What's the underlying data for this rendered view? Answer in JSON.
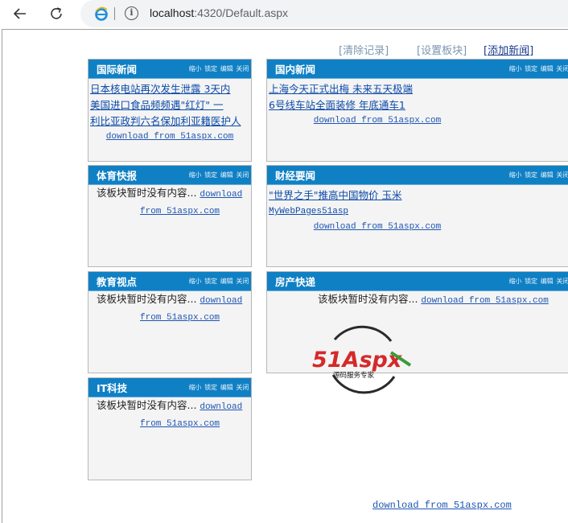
{
  "browser": {
    "url_host": "localhost",
    "url_rest": ":4320/Default.aspx"
  },
  "top_links": {
    "clear": "[清除记录]",
    "settings": "[设置板块]",
    "add_news": "[添加新闻]"
  },
  "block_actions": [
    "缩小",
    "锁定",
    "编辑",
    "关闭"
  ],
  "download_text": "download from 51aspx.com",
  "download_word": "download",
  "download_from": "from 51aspx.com",
  "empty_text": "该板块暂时没有内容...",
  "blocks": {
    "intl": {
      "title": "国际新闻",
      "items": [
        "日本核电站再次发生泄露 3天内",
        "美国进口食品频频遇\"红灯\" 一",
        "利比亚政判六名保加利亚籍医护人"
      ]
    },
    "domestic": {
      "title": "国内新闻",
      "items": [
        "上海今天正式出梅  未来五天极端",
        "6号线车站全面装修 年底通车1"
      ]
    },
    "sports": {
      "title": "体育快报"
    },
    "finance": {
      "title": "财经要闻",
      "items": [
        "\"世界之手\"推高中国物价 玉米",
        "MyWebPages51asp"
      ]
    },
    "education": {
      "title": "教育视点"
    },
    "realestate": {
      "title": "房产快递"
    },
    "it": {
      "title": "IT科技"
    }
  },
  "watermark": {
    "brand": "51Aspx",
    "tagline": "源码服务专家"
  },
  "colors": {
    "header_blue": "#1080c4",
    "link_blue": "#0d4aa8",
    "panel_bg": "#f4f4f4",
    "watermark_red": "#d42a2a",
    "watermark_green": "#3a9a3a"
  }
}
